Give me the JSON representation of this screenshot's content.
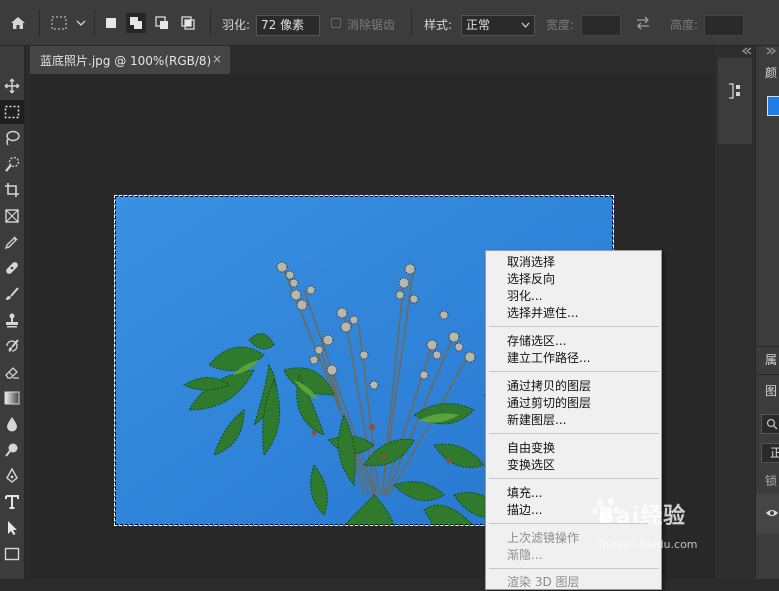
{
  "options_bar": {
    "feather_label": "羽化:",
    "feather_value": "72 像素",
    "antialias_label": "消除锯齿",
    "style_label": "样式:",
    "style_value": "正常",
    "width_label": "宽度:",
    "height_label": "高度:"
  },
  "document_tab": {
    "title": "蓝底照片.jpg @ 100%(RGB/8)",
    "close": "×"
  },
  "context_menu": {
    "groups": [
      [
        "取消选择",
        "选择反向",
        "羽化...",
        "选择并遮住..."
      ],
      [
        "存储选区...",
        "建立工作路径..."
      ],
      [
        "通过拷贝的图层",
        "通过剪切的图层",
        "新建图层..."
      ],
      [
        "自由变换",
        "变换选区"
      ],
      [
        "填充...",
        "描边..."
      ],
      [
        "上次滤镜操作",
        "渐隐..."
      ],
      [
        "渲染 3D 图层"
      ]
    ],
    "disabled": [
      "上次滤镜操作",
      "渐隐...",
      "渲染 3D 图层"
    ]
  },
  "right_panel": {
    "tab_color": "颜",
    "tab_properties": "属",
    "tab_layers": "图",
    "blend_mode": "正",
    "lock_label": "锁"
  },
  "watermark": {
    "brand": "Bai经验",
    "url": "jingyan.baidu.com"
  },
  "colors": {
    "foreground": "#1e7ee6",
    "annotation_arrow": "#e8262a"
  }
}
